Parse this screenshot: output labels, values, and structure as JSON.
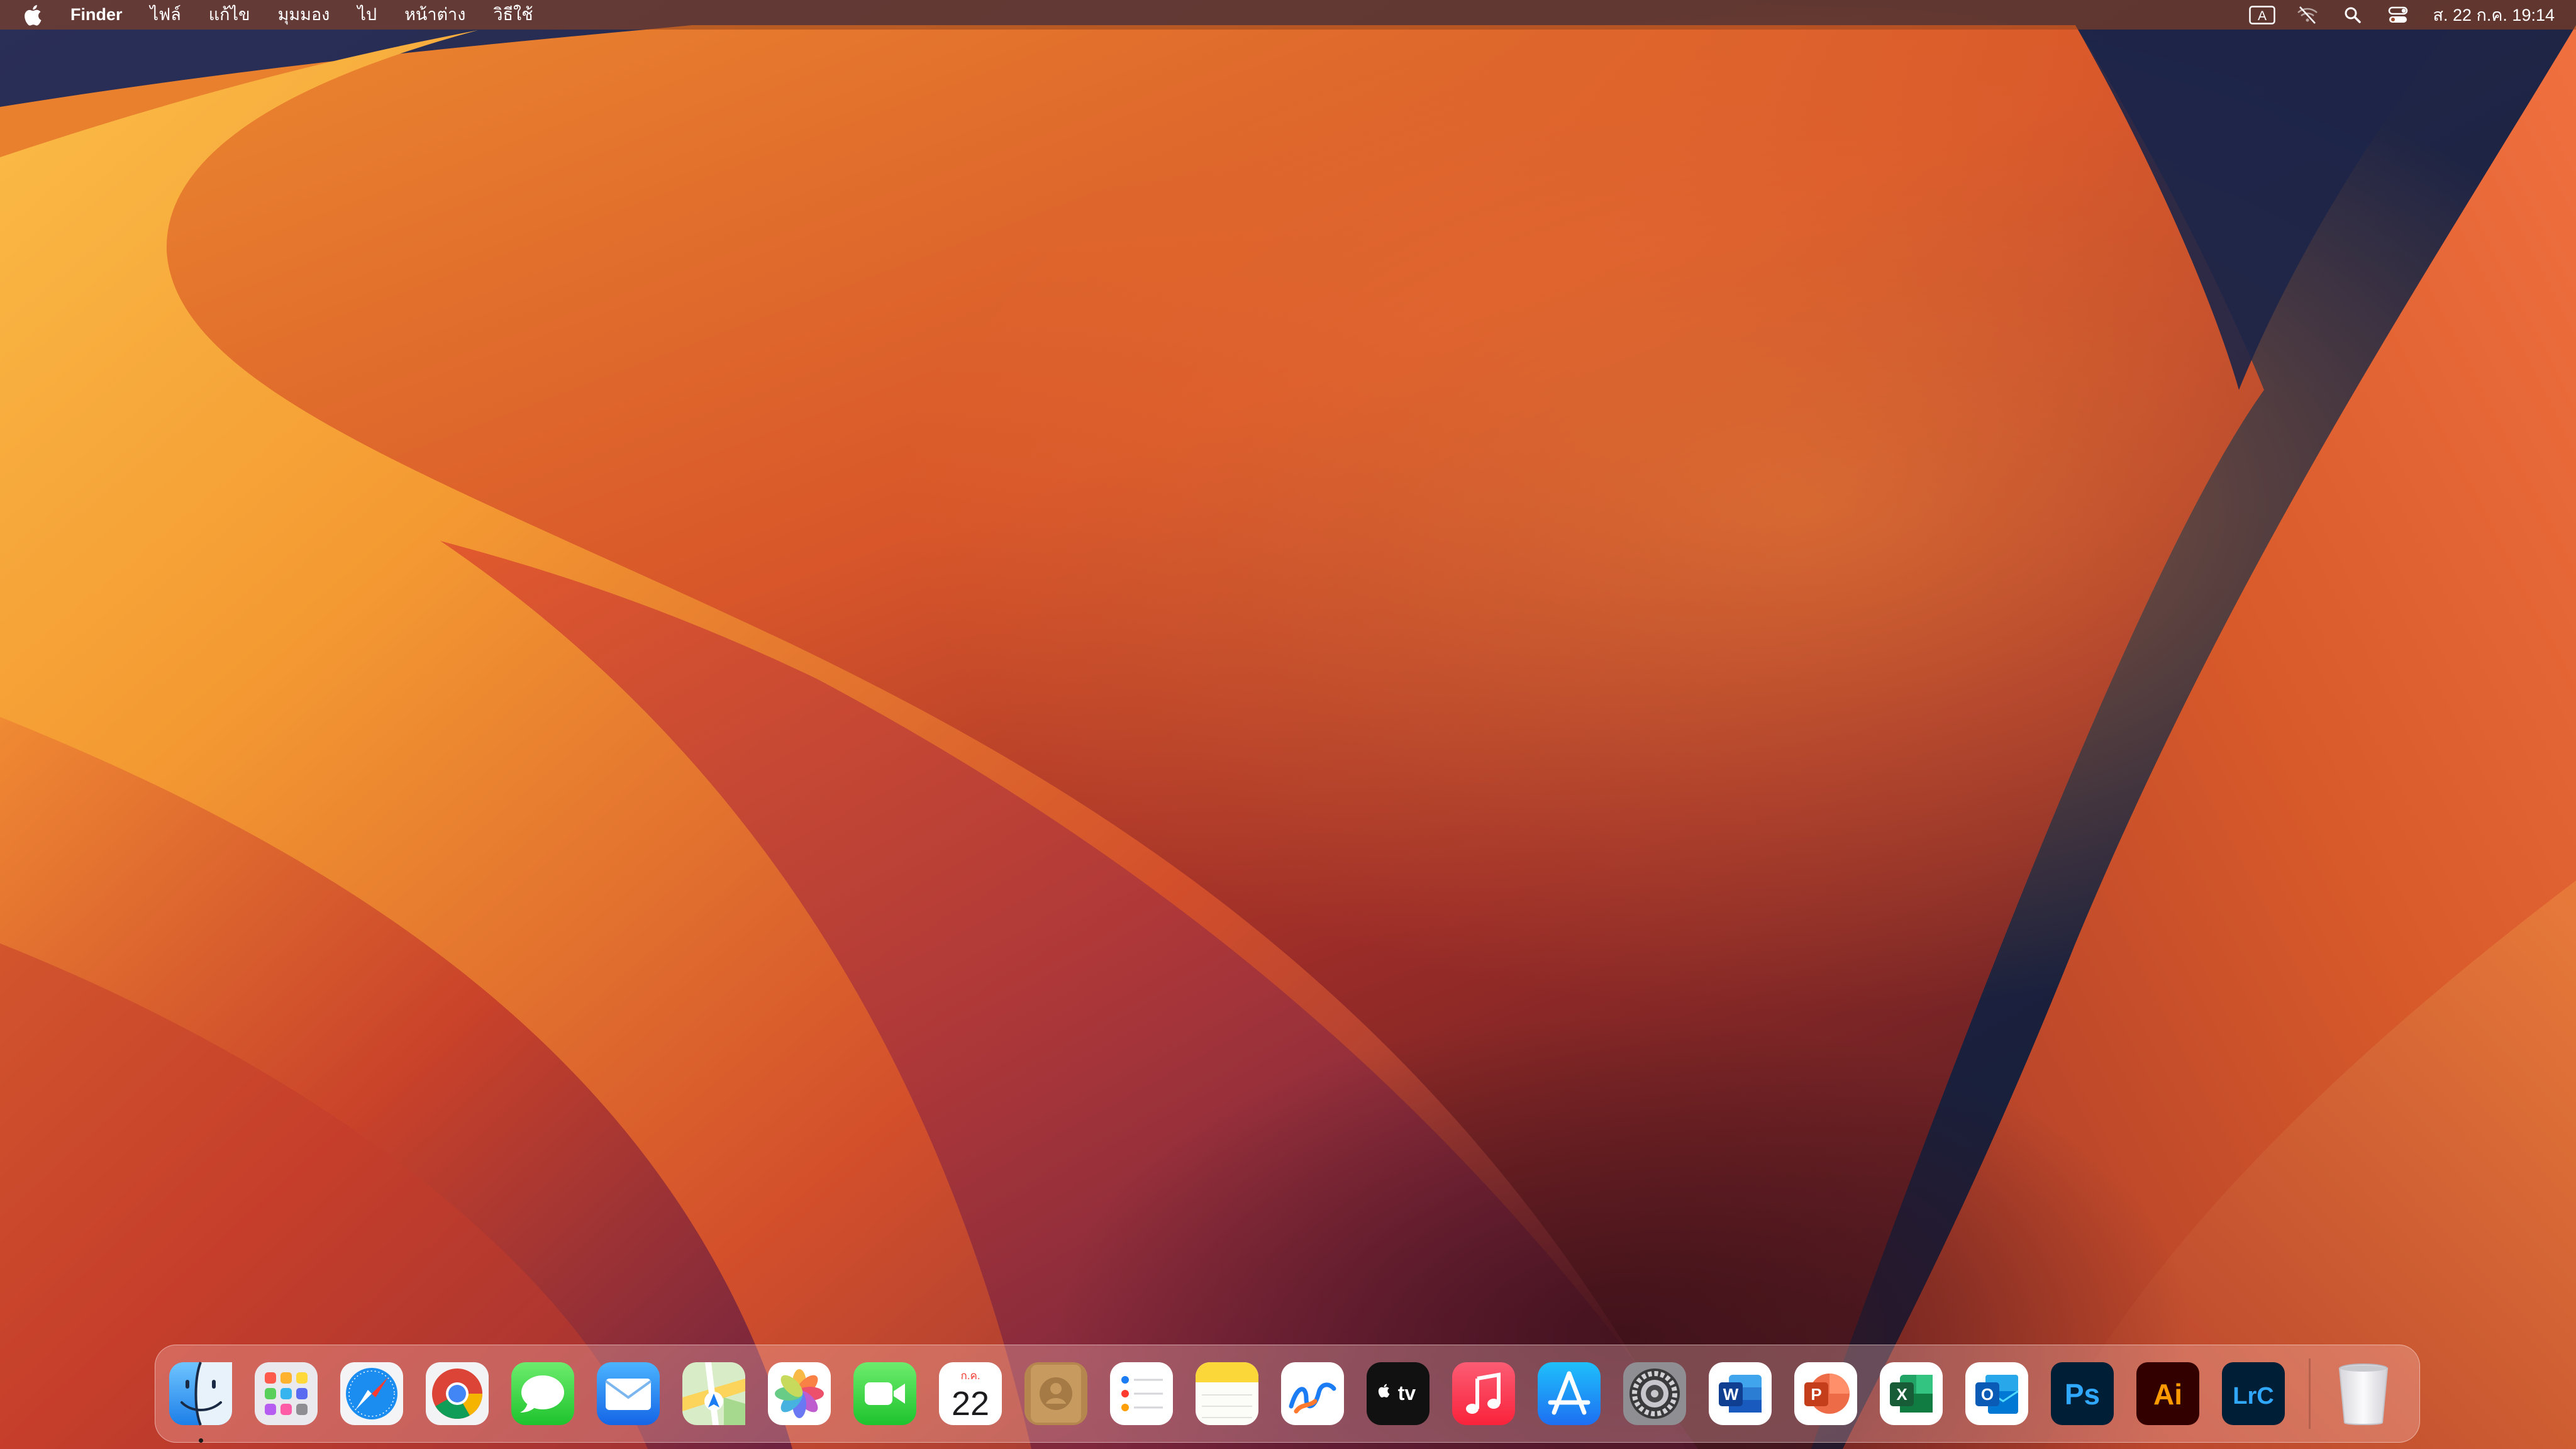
{
  "menubar": {
    "app_name": "Finder",
    "items": [
      "ไฟล์",
      "แก้ไข",
      "มุมมอง",
      "ไป",
      "หน้าต่าง",
      "วิธีใช้"
    ],
    "clock": "ส. 22 ก.ค.  19:14",
    "status_icons": [
      "input-source-icon",
      "wifi-off-icon",
      "spotlight-icon",
      "control-center-icon"
    ],
    "input_source_label": "A"
  },
  "dock": {
    "apps": [
      {
        "name": "Finder",
        "icon": "finder-icon",
        "running": true
      },
      {
        "name": "Launchpad",
        "icon": "launchpad-icon"
      },
      {
        "name": "Safari",
        "icon": "safari-icon"
      },
      {
        "name": "Google Chrome",
        "icon": "chrome-icon"
      },
      {
        "name": "Messages",
        "icon": "messages-icon"
      },
      {
        "name": "Mail",
        "icon": "mail-icon"
      },
      {
        "name": "Maps",
        "icon": "maps-icon"
      },
      {
        "name": "Photos",
        "icon": "photos-icon"
      },
      {
        "name": "FaceTime",
        "icon": "facetime-icon"
      },
      {
        "name": "Calendar",
        "icon": "calendar-icon",
        "month": "ก.ค.",
        "day": "22"
      },
      {
        "name": "Contacts",
        "icon": "contacts-icon"
      },
      {
        "name": "Reminders",
        "icon": "reminders-icon"
      },
      {
        "name": "Notes",
        "icon": "notes-icon"
      },
      {
        "name": "Freeform",
        "icon": "freeform-icon"
      },
      {
        "name": "TV",
        "icon": "tv-icon",
        "label": "tv"
      },
      {
        "name": "Music",
        "icon": "music-icon"
      },
      {
        "name": "App Store",
        "icon": "app-store-icon"
      },
      {
        "name": "System Settings",
        "icon": "system-settings-icon"
      },
      {
        "name": "Microsoft Word",
        "icon": "word-icon",
        "label": "W"
      },
      {
        "name": "Microsoft PowerPoint",
        "icon": "powerpoint-icon",
        "label": "P"
      },
      {
        "name": "Microsoft Excel",
        "icon": "excel-icon",
        "label": "X"
      },
      {
        "name": "Microsoft Outlook",
        "icon": "outlook-icon",
        "label": "O"
      },
      {
        "name": "Adobe Photoshop",
        "icon": "photoshop-icon",
        "label": "Ps"
      },
      {
        "name": "Adobe Illustrator",
        "icon": "illustrator-icon",
        "label": "Ai"
      },
      {
        "name": "Adobe Lightroom Classic",
        "icon": "lightroom-classic-icon",
        "label": "LrC"
      }
    ],
    "trash": {
      "name": "Trash",
      "icon": "trash-icon"
    }
  },
  "colors": {
    "wallpaper_deep": "#1c2743",
    "wallpaper_orange": "#e2662a",
    "wallpaper_yellow": "#fbbd47",
    "wallpaper_red": "#b43a2a",
    "photoshop_bg": "#001e36",
    "photoshop_fg": "#31a8ff",
    "illustrator_bg": "#330000",
    "illustrator_fg": "#ff9a00",
    "lightroom_bg": "#001e36",
    "lightroom_fg": "#31a8ff"
  }
}
